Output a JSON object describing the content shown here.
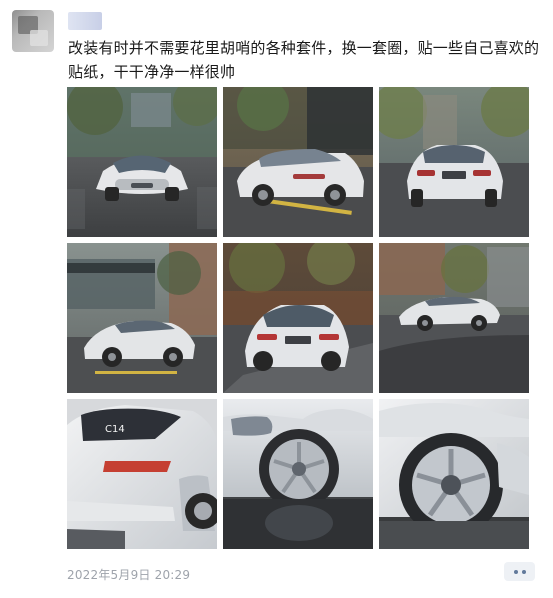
{
  "post": {
    "caption": "改装有时并不需要花里胡哨的各种套件，换一套圈，贴一些自己喜欢的贴纸，干干净净一样很帅",
    "timestamp": "2022年5月9日 20:29"
  },
  "gallery": {
    "images": [
      {
        "icon": "car-front-icon"
      },
      {
        "icon": "car-rear-icon"
      },
      {
        "icon": "car-rear-icon"
      },
      {
        "icon": "car-side-icon"
      },
      {
        "icon": "car-rear-icon"
      },
      {
        "icon": "car-side-icon"
      },
      {
        "icon": "car-rear-closeup-icon"
      },
      {
        "icon": "wheel-icon"
      },
      {
        "icon": "wheel-icon"
      }
    ]
  },
  "actions": {
    "more_icon": "more-options-icon"
  }
}
